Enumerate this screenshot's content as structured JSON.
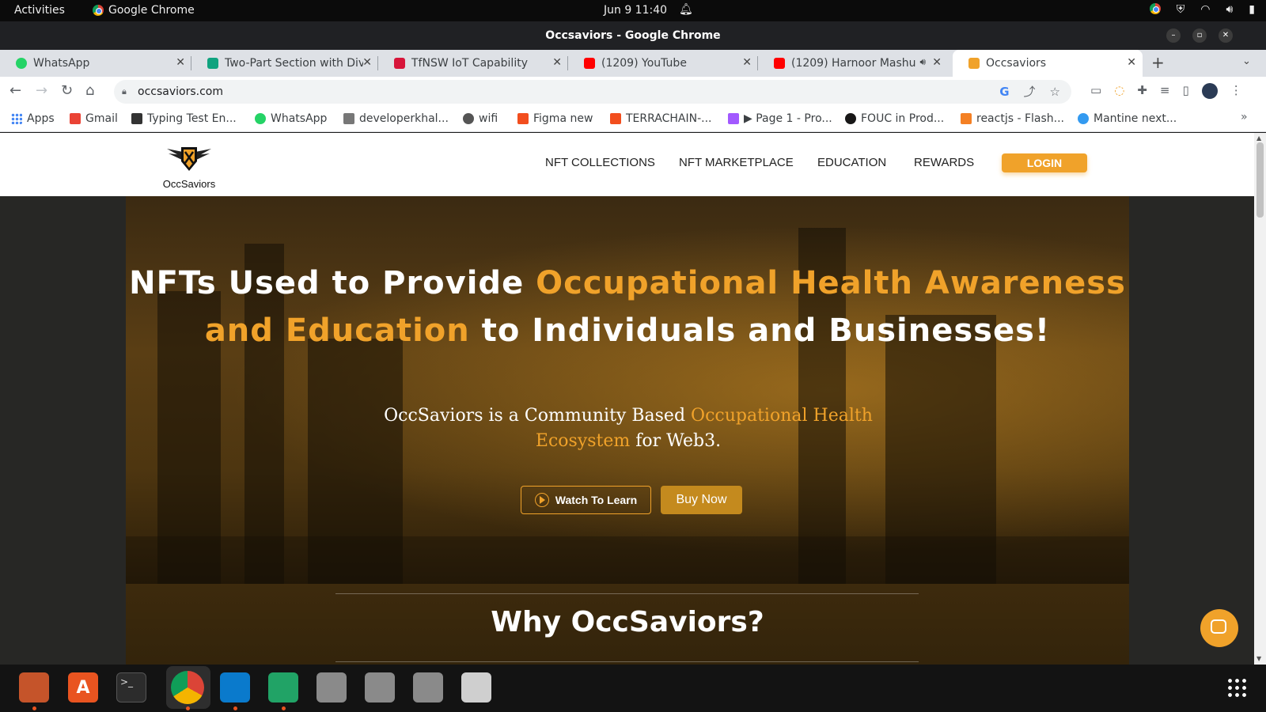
{
  "system": {
    "activities": "Activities",
    "app_name": "Google Chrome",
    "clock": "Jun 9  11:40"
  },
  "window": {
    "title": "Occsaviors - Google Chrome"
  },
  "tabs": [
    {
      "label": "WhatsApp",
      "color": "#25d366"
    },
    {
      "label": "Two-Part Section with Div",
      "color": "#10a37f"
    },
    {
      "label": "TfNSW IoT Capability",
      "color": "#d7153a"
    },
    {
      "label": "(1209) YouTube",
      "color": "#ff0000"
    },
    {
      "label": "(1209) Harnoor Mashu",
      "color": "#ff0000"
    },
    {
      "label": "Occsaviors",
      "color": "#f0a22a"
    }
  ],
  "address": {
    "url": "occsaviors.com"
  },
  "bookmarks": [
    {
      "label": "Apps",
      "color": "#4285f4"
    },
    {
      "label": "Gmail",
      "color": "#ea4335"
    },
    {
      "label": "Typing Test En...",
      "color": "#333333"
    },
    {
      "label": "WhatsApp",
      "color": "#25d366"
    },
    {
      "label": "developerkhal...",
      "color": "#777777"
    },
    {
      "label": "wifi",
      "color": "#555555"
    },
    {
      "label": "Figma new",
      "color": "#f24e1e"
    },
    {
      "label": "TERRACHAIN-...",
      "color": "#f24e1e"
    },
    {
      "label": "▶ Page 1 - Pro...",
      "color": "#a259ff"
    },
    {
      "label": "FOUC in Prod...",
      "color": "#181717"
    },
    {
      "label": "reactjs - Flash...",
      "color": "#f48024"
    },
    {
      "label": "Mantine next...",
      "color": "#339af0"
    }
  ],
  "site": {
    "logo_text": "OccSaviors",
    "nav": [
      "NFT COLLECTIONS",
      "NFT MARKETPLACE",
      "EDUCATION",
      "REWARDS"
    ],
    "login": "LOGIN",
    "hero": {
      "title_part1": "NFTs Used to Provide ",
      "title_highlight": "Occupational Health Awareness and Education",
      "title_part2": " to Individuals and Businesses!",
      "sub_part1": "OccSaviors is a Community Based ",
      "sub_highlight": "Occupational Health Ecosystem",
      "sub_part2": " for Web3.",
      "watch_button": "Watch To Learn",
      "buy_button": "Buy Now"
    },
    "why_title": "Why OccSaviors?",
    "accent_color": "#f0a22a"
  }
}
